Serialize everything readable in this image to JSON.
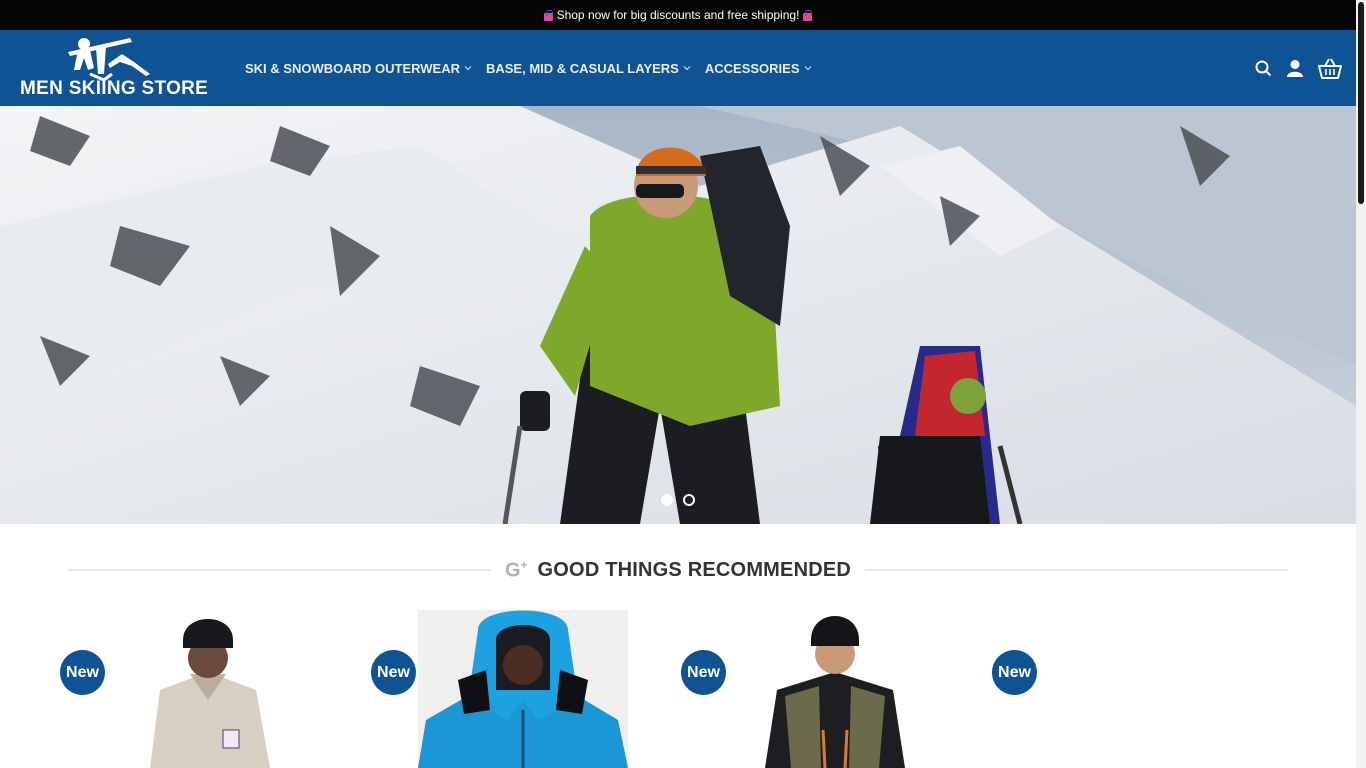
{
  "announcement": {
    "text": "Shop now for big discounts and free shipping!"
  },
  "logo": {
    "text": "MEN SKIING STORE"
  },
  "nav": {
    "items": [
      {
        "label": "SKI & SNOWBOARD OUTERWEAR"
      },
      {
        "label": "BASE, MID & CASUAL LAYERS"
      },
      {
        "label": "ACCESSORIES"
      }
    ]
  },
  "header_icons": [
    "search-icon",
    "user-icon",
    "basket-icon"
  ],
  "hero": {
    "slides": 2,
    "active_slide": 1
  },
  "section": {
    "title": "GOOD THINGS RECOMMENDED",
    "icon": "google-plus-icon"
  },
  "products": [
    {
      "badge": "New"
    },
    {
      "badge": "New"
    },
    {
      "badge": "New"
    },
    {
      "badge": "New"
    }
  ],
  "colors": {
    "brand_blue": "#0f5394",
    "top_bar": "#050505"
  }
}
